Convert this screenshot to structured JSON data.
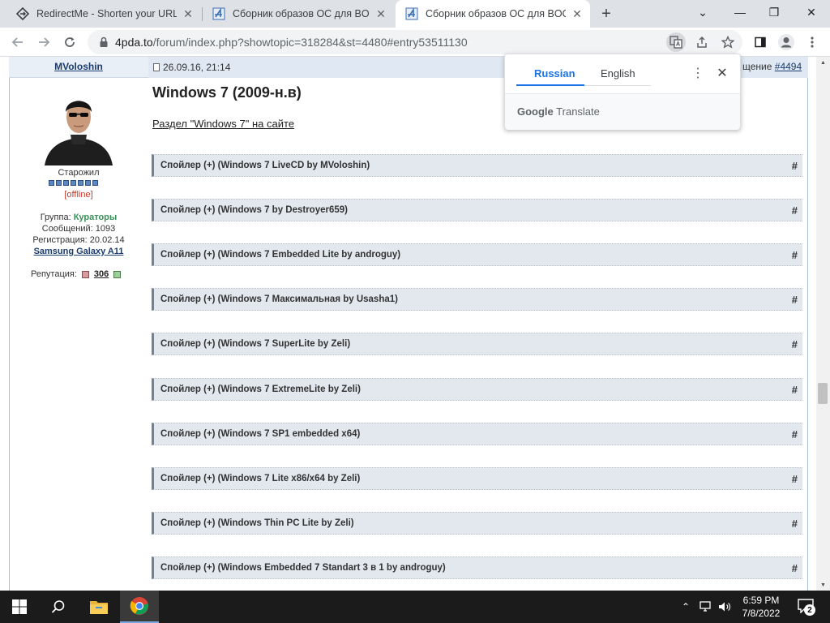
{
  "browser": {
    "tabs": [
      {
        "title": "RedirectMe - Shorten your URL t",
        "favicon": "redirect-icon",
        "active": false
      },
      {
        "title": "Сборник образов ОС для BOCHS",
        "favicon": "4pda-icon",
        "active": false
      },
      {
        "title": "Сборник образов ОС для BOCHS",
        "favicon": "4pda-icon",
        "active": true
      }
    ],
    "new_tab_label": "+",
    "url_host": "4pda.to",
    "url_path": "/forum/index.php?showtopic=318284&st=4480#entry53511130"
  },
  "post": {
    "author": "MVoloshin",
    "date": "26.09.16, 21:14",
    "number_prefix": "щение",
    "number_link": "#4494",
    "rank": "Старожил",
    "status": "[offline]",
    "group_label": "Группа:",
    "group_value": "Кураторы",
    "messages": "Сообщений: 1093",
    "registered": "Регистрация: 20.02.14",
    "device": "Samsung Galaxy A11",
    "reputation_label": "Репутация:",
    "reputation_value": "306",
    "title": "Windows 7 (2009-н.в)",
    "section_link": "Раздел \"Windows 7\" на сайте",
    "spoilers": [
      "Спойлер (+) (Windows 7 LiveCD by MVoloshin)",
      "Спойлер (+) (Windows 7 by Destroyer659)",
      "Спойлер (+) (Windows 7 Embedded Lite by androguy)",
      "Спойлер (+) (Windows 7 Максимальная by Usasha1)",
      "Спойлер (+) (Windows 7 SuperLite by Zeli)",
      "Спойлер (+) (Windows 7 ExtremeLite by Zeli)",
      "Спойлер (+) (Windows 7 SP1 embedded x64)",
      "Спойлер (+) (Windows 7 Lite x86/x64 by Zeli)",
      "Спойлер (+) (Windows Thin PC Lite by Zeli)",
      "Спойлер (+) (Windows Embedded 7 Standart 3 в 1 by androguy)"
    ],
    "spoiler_anchor": "#"
  },
  "translate_popup": {
    "lang_from": "Russian",
    "lang_to": "English",
    "brand_google": "Google",
    "brand_translate": "Translate"
  },
  "taskbar": {
    "time": "6:59 PM",
    "date": "7/8/2022",
    "notification_count": "2"
  },
  "colors": {
    "accent": "#1a73e8",
    "group_green": "#3a8f5a",
    "spoiler_bg": "#e3e8ee",
    "header_bg": "#dfe8f3"
  }
}
